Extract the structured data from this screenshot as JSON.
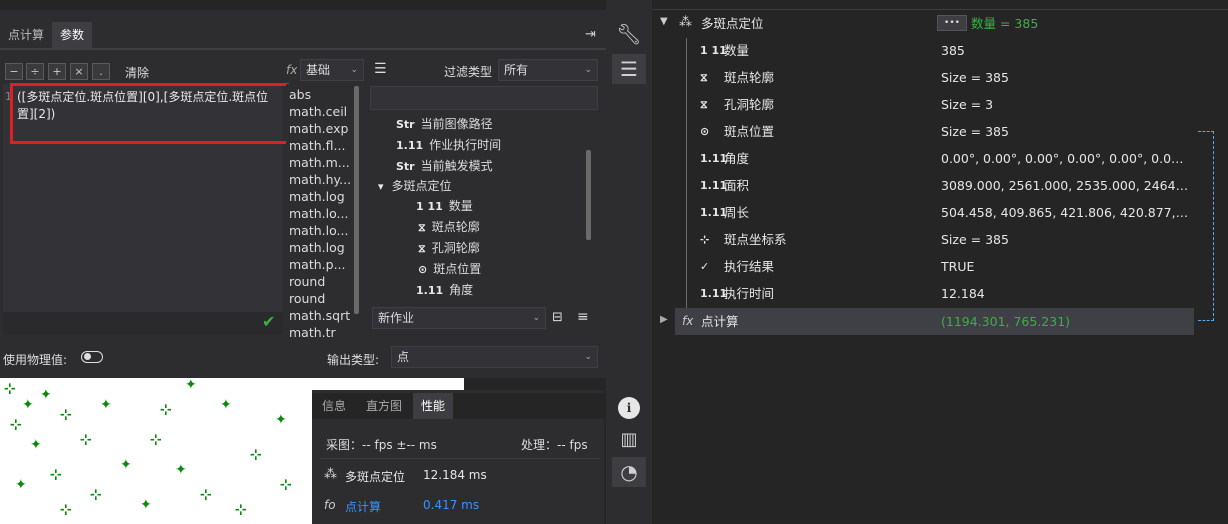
{
  "tabs": [
    {
      "label": "点计算"
    },
    {
      "label": "参数"
    }
  ],
  "pin_icon": "pin-icon",
  "calc": {
    "ops": [
      "−",
      "÷",
      "+",
      "×",
      "."
    ],
    "clear_label": "清除",
    "line_no": "1",
    "expression": "([多斑点定位.斑点位置][0],[多斑点定位.斑点位置][2])",
    "fx_label": "fx",
    "category": "基础",
    "functions": [
      "abs",
      "math.ceil",
      "math.exp",
      "math.fl...",
      "math.m...",
      "math.hy...",
      "math.log",
      "math.lo...",
      "math.lo...",
      "math.log",
      "math.p...",
      "round",
      "round",
      "math.sqrt",
      "math.tr"
    ],
    "filter_label": "过滤类型",
    "filter_value": "所有",
    "search_value": "",
    "tree": [
      {
        "icon": "Str",
        "label": "当前图像路径",
        "level": 0
      },
      {
        "icon": "1.11",
        "label": "作业执行时间",
        "level": 0
      },
      {
        "icon": "Str",
        "label": "当前触发模式",
        "level": 0
      },
      {
        "icon": "▾",
        "label": "多斑点定位",
        "level": 0
      },
      {
        "icon": "1 11",
        "label": "数量",
        "level": 1
      },
      {
        "icon": "⧖",
        "label": "斑点轮廓",
        "level": 1
      },
      {
        "icon": "⧖",
        "label": "孔洞轮廓",
        "level": 1
      },
      {
        "icon": "⊙",
        "label": "斑点位置",
        "level": 1
      },
      {
        "icon": "1.11",
        "label": "角度",
        "level": 1
      }
    ],
    "job_select": "新作业",
    "physical_label": "使用物理值:",
    "output_label": "输出类型:",
    "output_value": "点"
  },
  "bottom_panel": {
    "tabs": [
      {
        "label": "信息"
      },
      {
        "label": "直方图"
      },
      {
        "label": "性能"
      }
    ],
    "acquire": "采图：-- fps ±-- ms",
    "process": "处理：-- fps",
    "rows": [
      {
        "icon": "blob-icon",
        "name": "多斑点定位",
        "time": "12.184 ms",
        "color": "#e6e6e6"
      },
      {
        "icon": "fx-icon",
        "name": "点计算",
        "time": "0.417 ms",
        "color": "#3794ff"
      }
    ]
  },
  "side_icons": [
    "wrench-icon",
    "sliders-icon",
    "info-icon",
    "chart-icon",
    "gauge-icon"
  ],
  "props": {
    "root": {
      "label": "多斑点定位",
      "btn": "•••",
      "value": "数量 = 385",
      "value_color": "#3cb043"
    },
    "rows": [
      {
        "icon": "1 11",
        "label": "数量",
        "value": "385"
      },
      {
        "icon": "⧖",
        "label": "斑点轮廓",
        "value": "Size = 385"
      },
      {
        "icon": "⧖",
        "label": "孔洞轮廓",
        "value": "Size = 3"
      },
      {
        "icon": "⊙",
        "label": "斑点位置",
        "value": "Size = 385"
      },
      {
        "icon": "1.11",
        "label": "角度",
        "value": "0.00°, 0.00°, 0.00°, 0.00°, 0.00°, 0.00°, 0.0..."
      },
      {
        "icon": "1.11",
        "label": "面积",
        "value": "3089.000, 2561.000, 2535.000, 2464.000, ..."
      },
      {
        "icon": "1.11",
        "label": "周长",
        "value": "504.458, 409.865, 421.806, 420.877, 423...."
      },
      {
        "icon": "⊹",
        "label": "斑点坐标系",
        "value": "Size = 385"
      },
      {
        "icon": "✓",
        "label": "执行结果",
        "value": "TRUE"
      },
      {
        "icon": "1.11",
        "label": "执行时间",
        "value": "12.184"
      }
    ],
    "calc_row": {
      "icon": "fx",
      "label": "点计算",
      "value": "(1194.301, 765.231)",
      "value_color": "#3cb043"
    }
  }
}
